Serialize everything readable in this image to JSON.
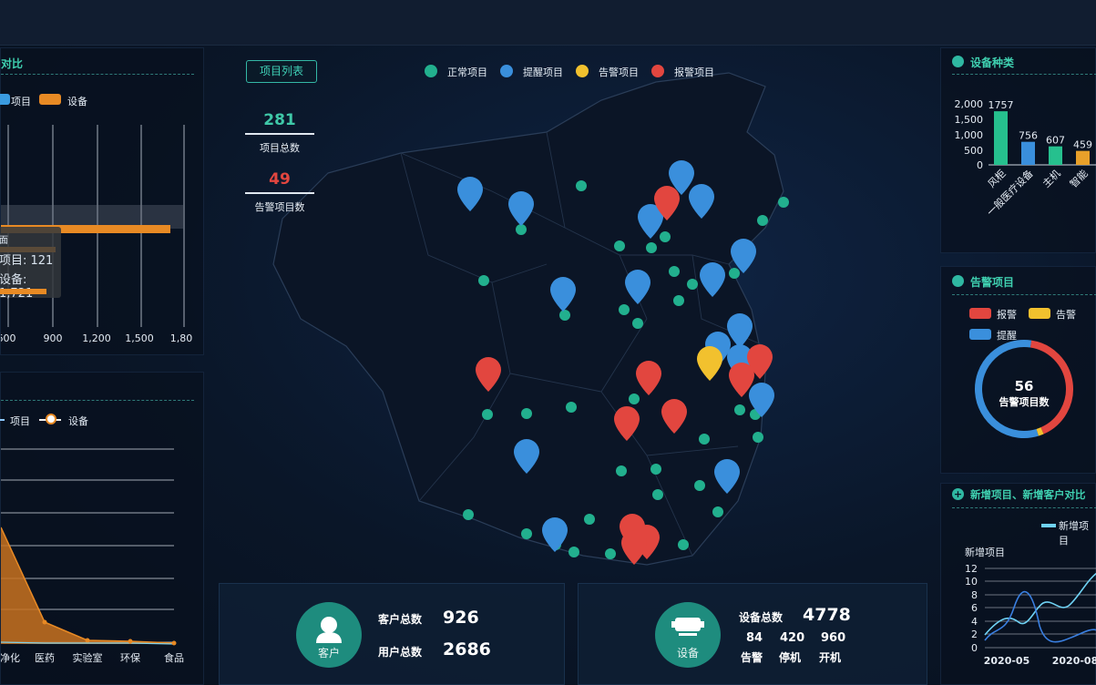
{
  "left_top": {
    "title_fragment": "对比",
    "legend": [
      {
        "label": "项目",
        "color": "#3a9be0"
      },
      {
        "label": "设备",
        "color": "#e88a24"
      }
    ],
    "x_ticks": [
      "600",
      "900",
      "1,200",
      "1,500",
      "1,80"
    ],
    "tooltip": {
      "line1": "面",
      "line2": "项目: 121",
      "line3": "设备: 1,721"
    },
    "bar_value_fraction": 0.92
  },
  "left_bottom": {
    "legend": [
      {
        "label": "项目"
      },
      {
        "label": "设备"
      }
    ],
    "x_ticks": [
      "净化",
      "医药",
      "实验室",
      "环保",
      "食品"
    ]
  },
  "map": {
    "project_list_button": "项目列表",
    "legend": [
      {
        "label": "正常项目",
        "color": "#22b08e"
      },
      {
        "label": "提醒项目",
        "color": "#3a8fdc"
      },
      {
        "label": "告警项目",
        "color": "#f2c12e"
      },
      {
        "label": "报警项目",
        "color": "#e2463f"
      }
    ],
    "total_projects": {
      "value": "281",
      "label": "项目总数",
      "color": "#3fc8a8"
    },
    "alarm_projects": {
      "value": "49",
      "label": "告警项目数",
      "color": "#e2463f"
    }
  },
  "bottom_customer": {
    "icon_label": "客户",
    "customer_total_label": "客户总数",
    "customer_total_value": "926",
    "user_total_label": "用户总数",
    "user_total_value": "2686"
  },
  "bottom_device": {
    "icon_label": "设备",
    "device_total_label": "设备总数",
    "device_total_value": "4778",
    "stats": [
      {
        "value": "84",
        "label": "告警"
      },
      {
        "value": "420",
        "label": "停机"
      },
      {
        "value": "960",
        "label": "开机"
      }
    ]
  },
  "device_types": {
    "title": "设备种类",
    "chart_data": {
      "type": "bar",
      "categories": [
        "风柜",
        "一般医疗设备",
        "主机",
        "智能"
      ],
      "values": [
        1757,
        756,
        607,
        459
      ],
      "colors": [
        "#26c08e",
        "#3a8fdc",
        "#26c08e",
        "#e8a02a"
      ],
      "y_ticks": [
        "2,000",
        "1,500",
        "1,000",
        "500",
        "0"
      ],
      "ylim": [
        0,
        2000
      ]
    }
  },
  "alarm_projects_panel": {
    "title": "告警项目",
    "legend": [
      {
        "label": "报警",
        "color": "#e2463f"
      },
      {
        "label": "告警",
        "color": "#f2c12e"
      },
      {
        "label": "提醒",
        "color": "#3a8fdc"
      }
    ],
    "donut_value": "56",
    "donut_label": "告警项目数",
    "chart_data": {
      "type": "pie",
      "categories": [
        "报警",
        "告警",
        "提醒"
      ],
      "values": [
        23,
        1,
        32
      ]
    }
  },
  "new_projects_panel": {
    "title": "新增项目、新增客户对比",
    "legend_label": "新增项目",
    "chart_title": "新增项目",
    "y_ticks": [
      "12",
      "10",
      "8",
      "6",
      "4",
      "2",
      "0"
    ],
    "x_ticks": [
      "2020-05",
      "2020-08"
    ]
  }
}
